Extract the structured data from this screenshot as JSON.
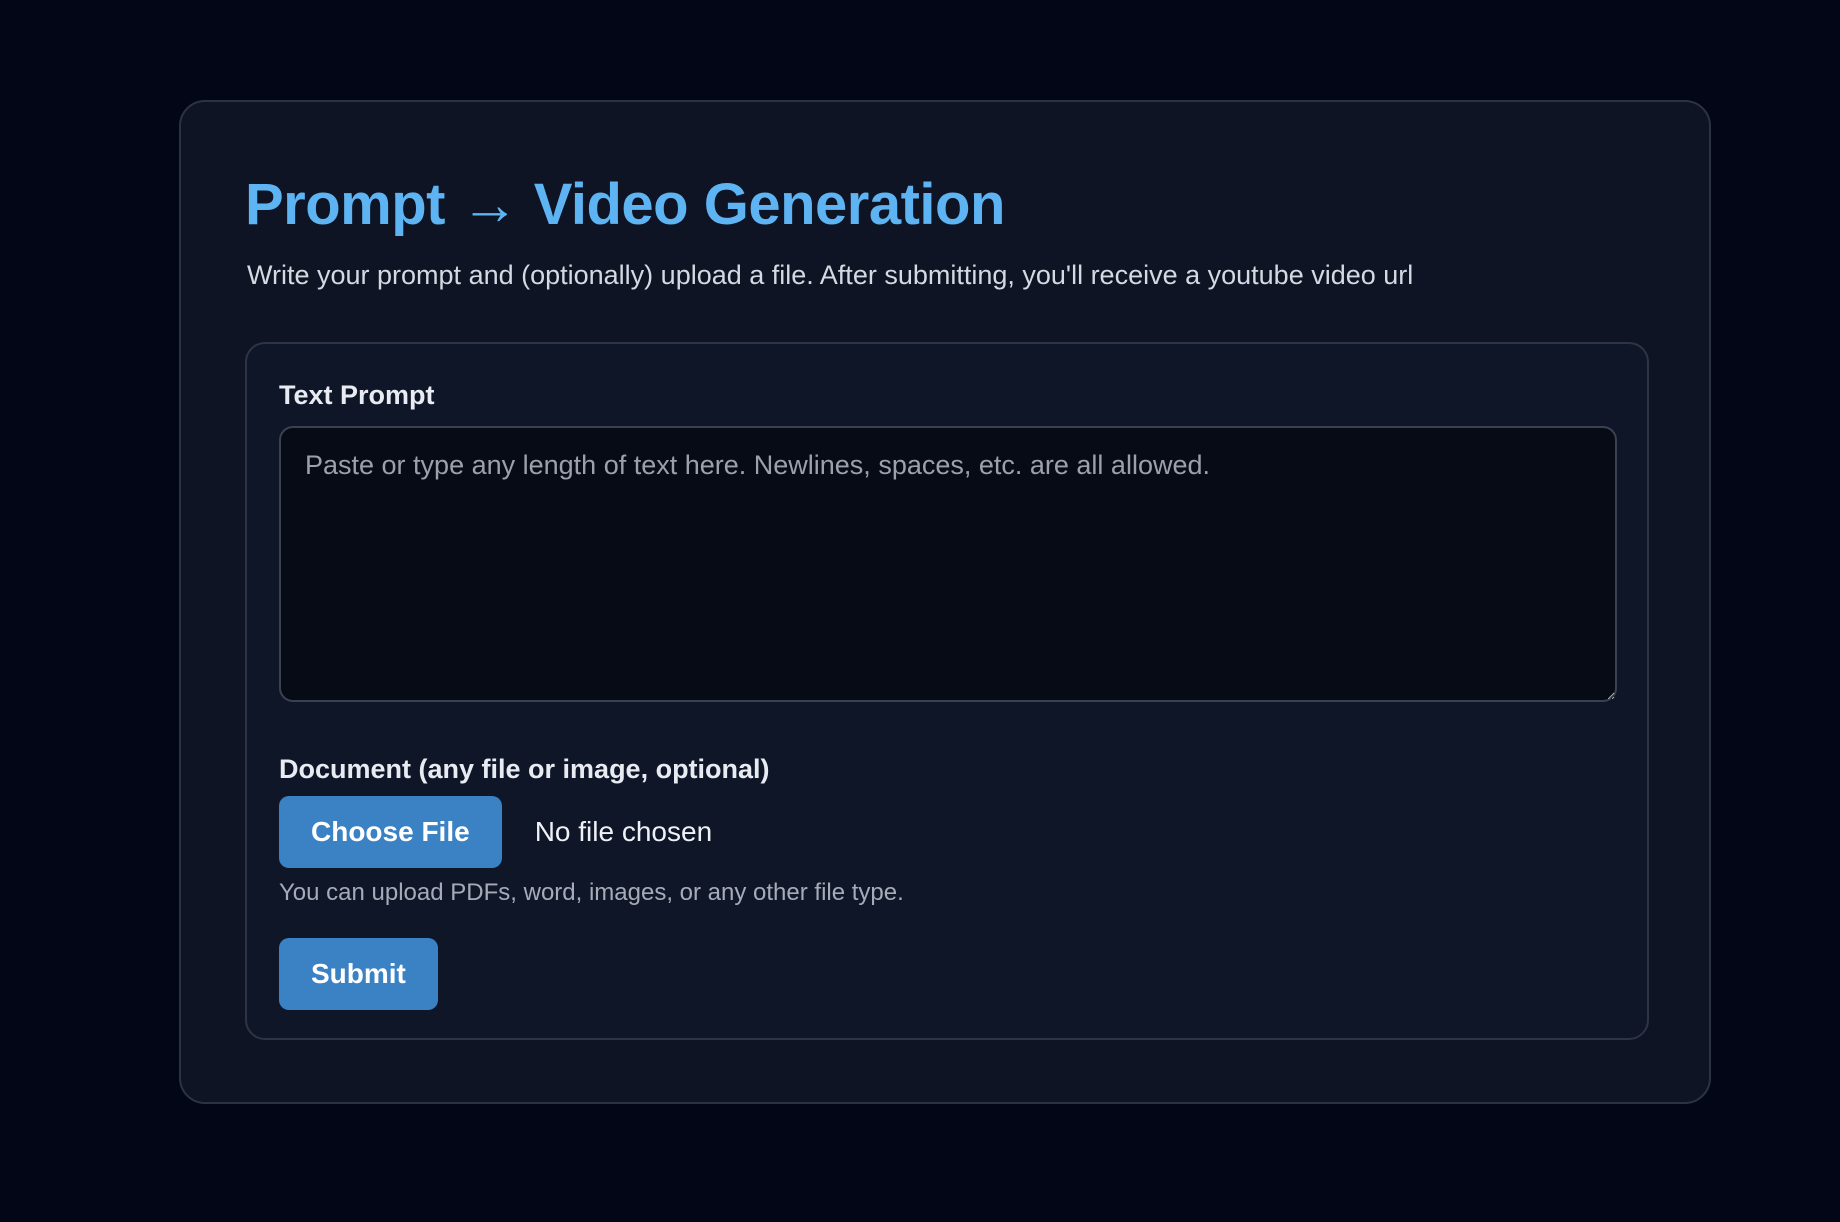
{
  "header": {
    "title": "Prompt → Video Generation",
    "subtitle": "Write your prompt and (optionally) upload a file. After submitting, you'll receive a youtube video url"
  },
  "form": {
    "prompt_label": "Text Prompt",
    "prompt_placeholder": "Paste or type any length of text here. Newlines, spaces, etc. are all allowed.",
    "prompt_value": "",
    "document_label": "Document (any file or image, optional)",
    "choose_file_label": "Choose File",
    "file_status": "No file chosen",
    "upload_hint": "You can upload PDFs, word, images, or any other file type.",
    "submit_label": "Submit"
  },
  "colors": {
    "background": "#020617",
    "card": "#0e1424",
    "accent_title": "#5eb4f2",
    "button": "#3b82c4"
  }
}
